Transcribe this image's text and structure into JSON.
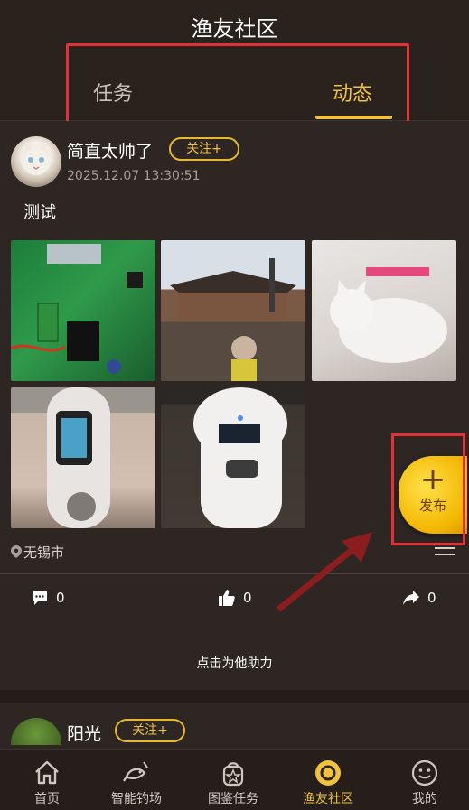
{
  "header": {
    "title": "渔友社区",
    "tabs": [
      "任务",
      "动态"
    ],
    "active_tab": "动态"
  },
  "post1": {
    "username": "简直太帅了",
    "follow_label": "关注+",
    "timestamp": "2025.12.07 13:30:51",
    "text": "测试",
    "location": "无锡市",
    "comments": "0",
    "likes": "0",
    "shares": "0",
    "help_text": "点击为他助力"
  },
  "post2": {
    "username": "阳光",
    "follow_label": "关注+"
  },
  "fab": {
    "plus": "+",
    "label": "发布"
  },
  "tabbar": {
    "items": [
      {
        "label": "首页",
        "icon": "home-icon"
      },
      {
        "label": "智能钓场",
        "icon": "fishing-icon"
      },
      {
        "label": "图鉴任务",
        "icon": "badge-icon"
      },
      {
        "label": "渔友社区",
        "icon": "community-icon"
      },
      {
        "label": "我的",
        "icon": "profile-icon"
      }
    ],
    "active": "渔友社区"
  },
  "colors": {
    "accent": "#f1c33c",
    "highlight": "#e5303a",
    "background": "#2b2420"
  }
}
